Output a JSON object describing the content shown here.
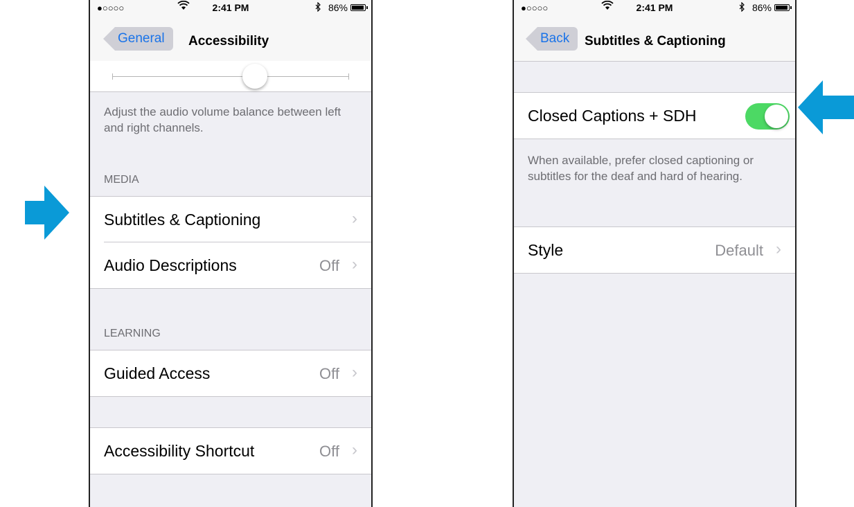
{
  "status_bar": {
    "signal": "●○○○○",
    "wifi_icon": "wifi-icon",
    "time": "2:41 PM",
    "bluetooth_icon": "bluetooth-icon",
    "battery_percent": "86%",
    "battery_level": 0.86
  },
  "left_screen": {
    "back_label": "General",
    "title": "Accessibility",
    "balance_slider_value": 0.5,
    "balance_description": "Adjust the audio volume balance between left and right channels.",
    "media_header": "MEDIA",
    "media_items": [
      {
        "label": "Subtitles & Captioning",
        "value": ""
      },
      {
        "label": "Audio Descriptions",
        "value": "Off"
      }
    ],
    "learning_header": "LEARNING",
    "guided_access": {
      "label": "Guided Access",
      "value": "Off"
    },
    "shortcut": {
      "label": "Accessibility Shortcut",
      "value": "Off"
    }
  },
  "right_screen": {
    "back_label": "Back",
    "title": "Subtitles & Captioning",
    "cc_label": "Closed Captions + SDH",
    "cc_enabled": true,
    "cc_description": "When available, prefer closed captioning or subtitles for the deaf and hard of hearing.",
    "style_label": "Style",
    "style_value": "Default"
  },
  "annotations": {
    "arrow_color": "#0a9ad7",
    "toggle_on_color": "#4cd964",
    "link_color": "#1a73e8"
  },
  "icons": {
    "chevron": "›"
  }
}
